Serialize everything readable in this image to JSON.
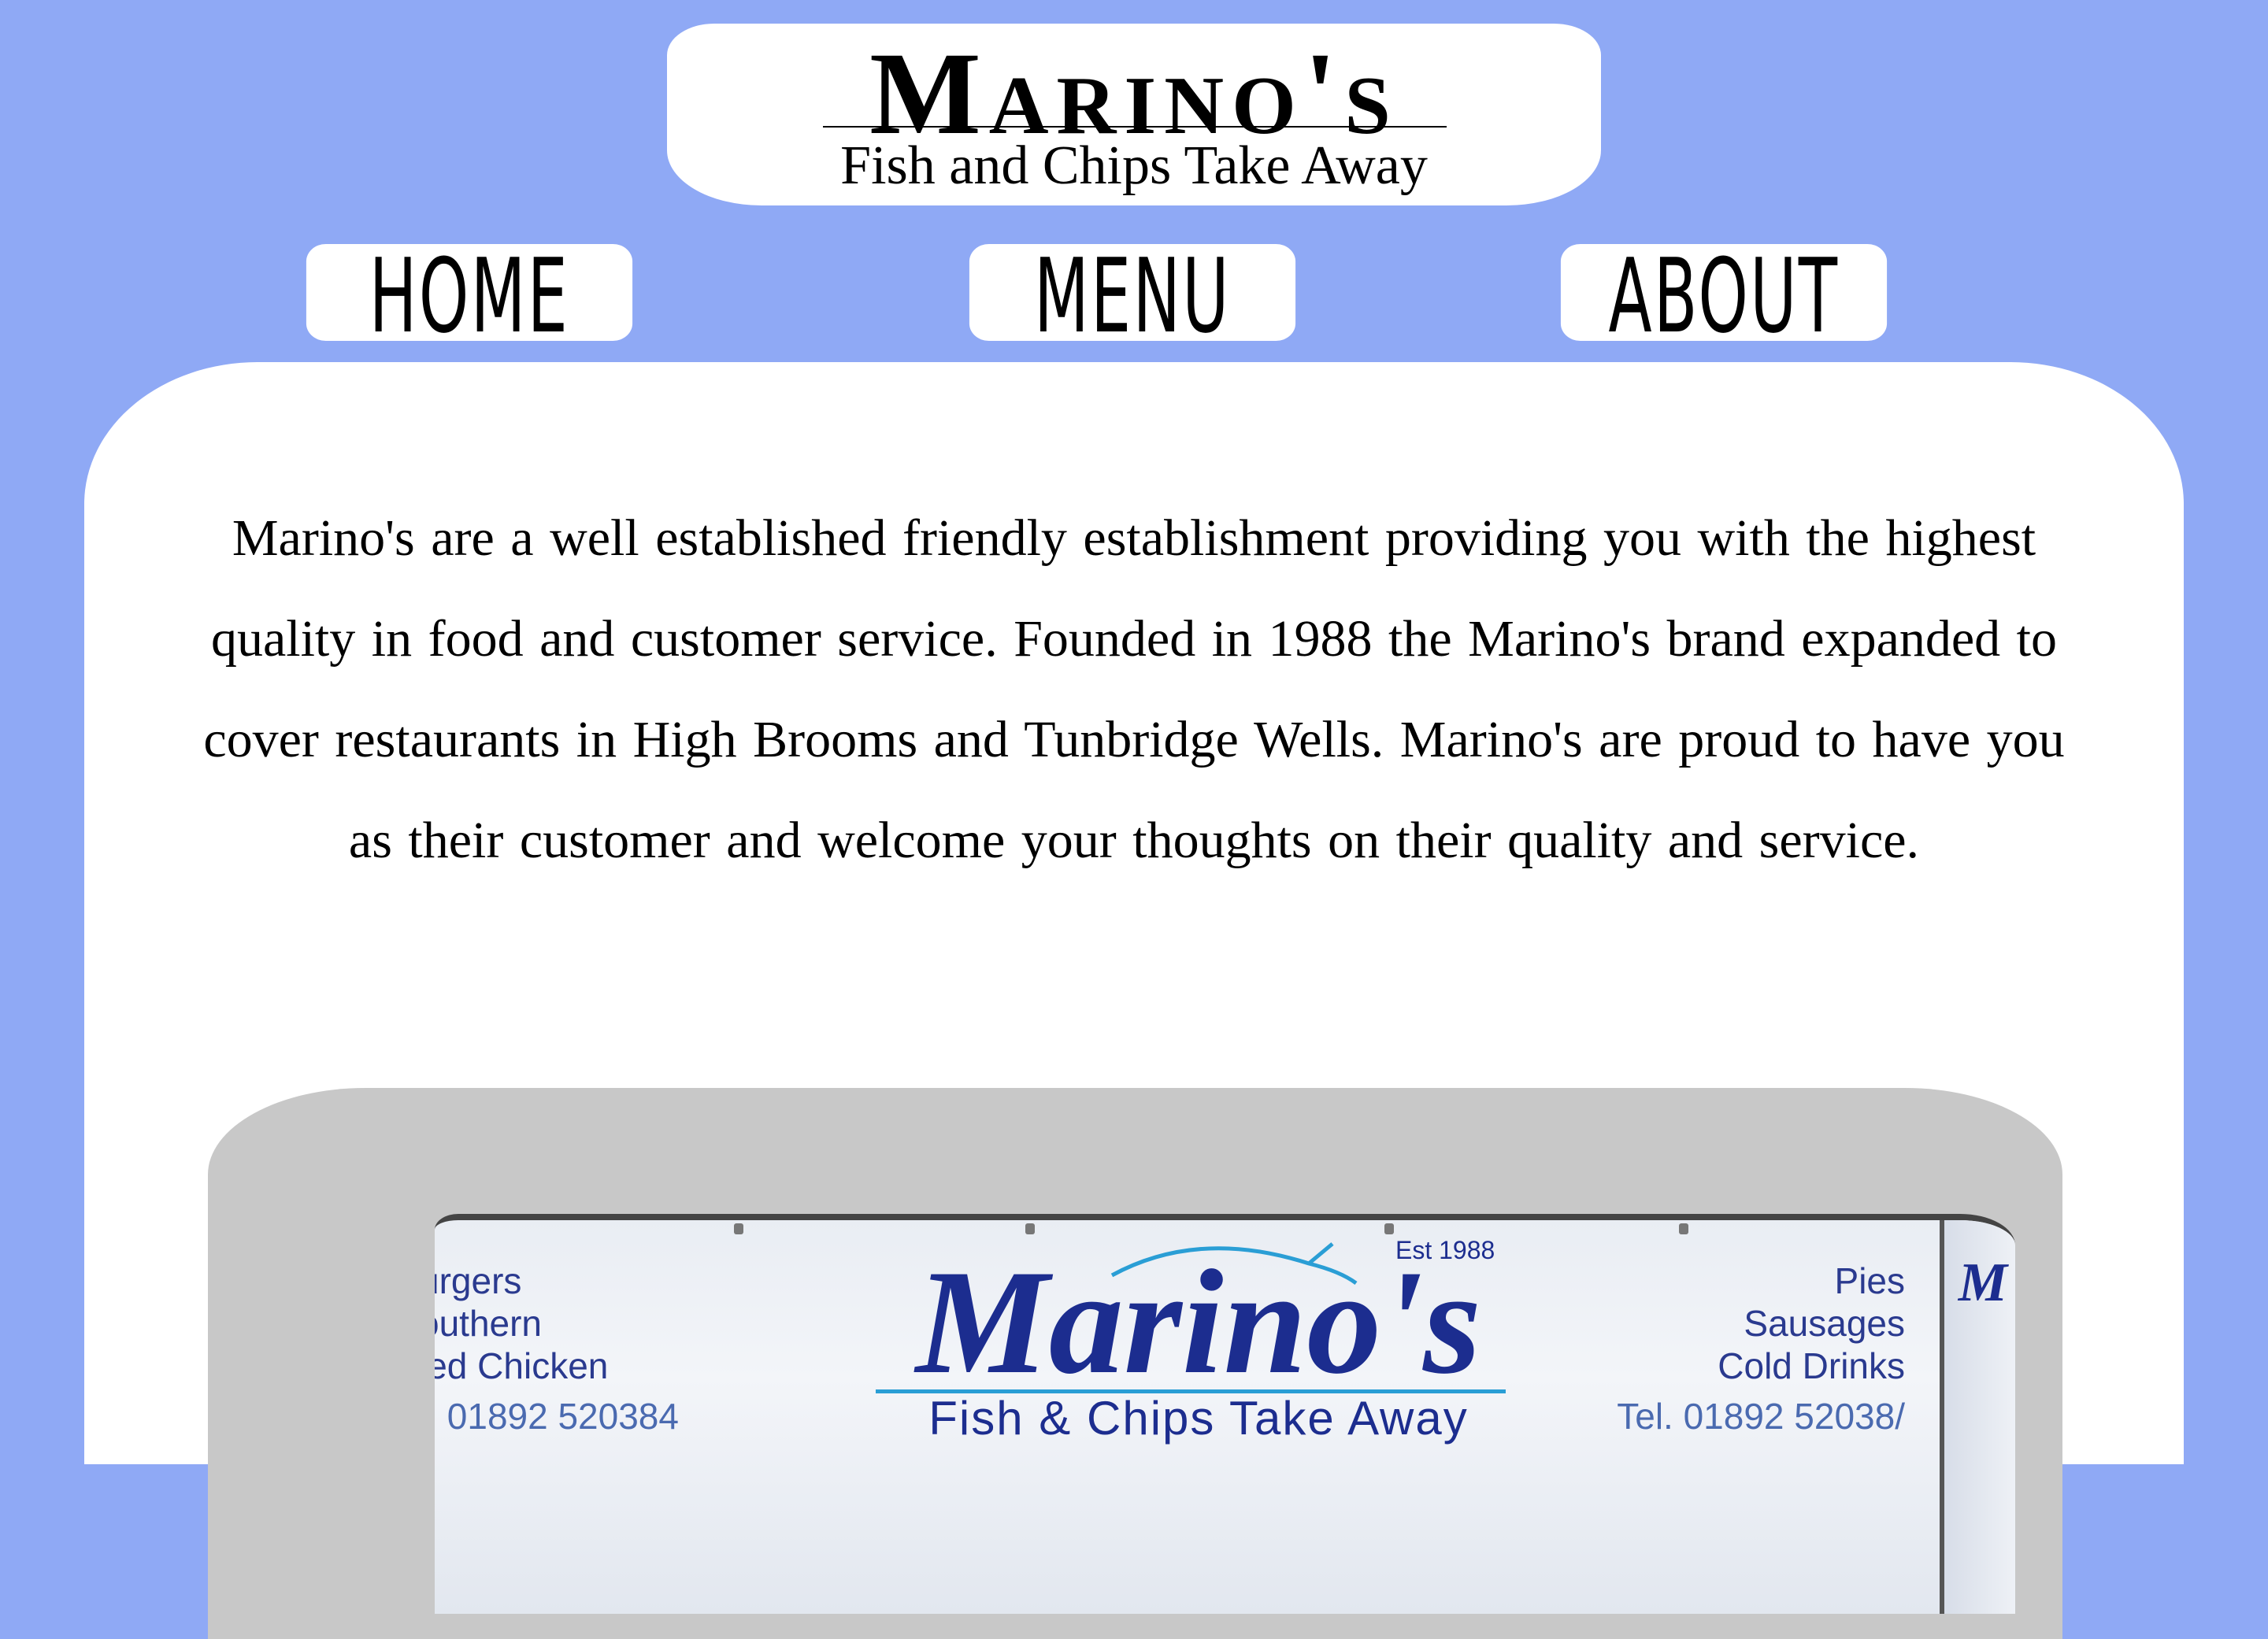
{
  "header": {
    "title": "Marino's",
    "subtitle": "Fish and Chips Take Away"
  },
  "nav": {
    "items": [
      {
        "label": "HOME"
      },
      {
        "label": "MENU"
      },
      {
        "label": "ABOUT"
      }
    ]
  },
  "main": {
    "intro_text": "Marino's are a well established friendly establishment providing you with the highest quality in food and customer service.  Founded in 1988 the Marino's brand expanded to cover restaurants in High Brooms and Tunbridge Wells. Marino's are proud to have you as their customer and welcome your thoughts on their quality and service."
  },
  "photo": {
    "brand": "Marino's",
    "est": "Est 1988",
    "tagline": "Fish & Chips Take Away",
    "left_items": [
      "urgers",
      "outhern",
      "ied Chicken"
    ],
    "right_items": [
      "Pies",
      "Sausages",
      "Cold Drinks"
    ],
    "tel_left": "l. 01892 520384",
    "tel_right": "Tel. 01892 52038/"
  },
  "colors": {
    "background": "#8fa9f5",
    "panel": "#ffffff",
    "photo_frame": "#c8c8c8",
    "sign_text": "#1c2d8f"
  }
}
